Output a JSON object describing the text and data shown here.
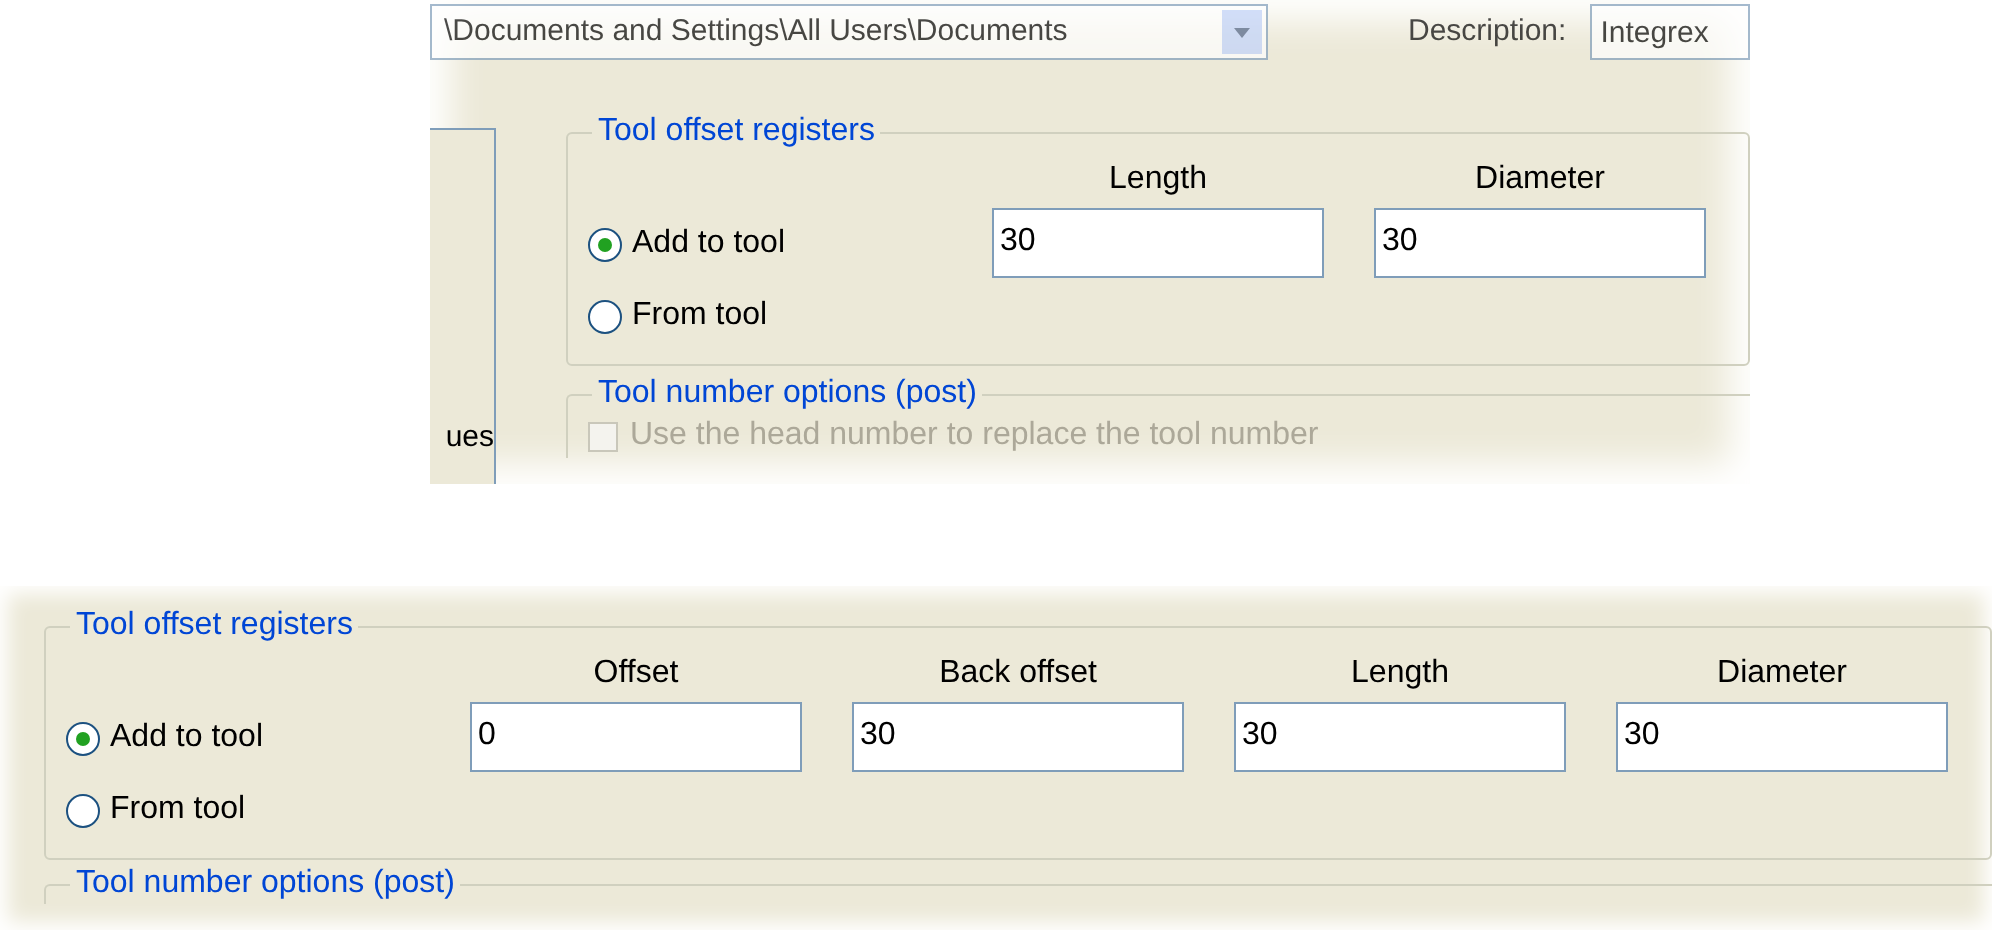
{
  "panels": [
    {
      "path_field": "\\Documents and Settings\\All Users\\Documents",
      "description_label": "Description:",
      "description_field": "Integrex",
      "side_label": "ues",
      "offset_group": {
        "title": "Tool offset registers",
        "options": [
          {
            "label": "Add to tool",
            "selected": true
          },
          {
            "label": "From tool",
            "selected": false
          }
        ],
        "fields": [
          {
            "label": "Length",
            "value": "30"
          },
          {
            "label": "Diameter",
            "value": "30"
          }
        ]
      },
      "number_group": {
        "title": "Tool number options (post)",
        "checkbox": {
          "label": "Use the head number to replace the tool number",
          "checked": false,
          "disabled": true
        }
      }
    },
    {
      "offset_group": {
        "title": "Tool offset registers",
        "options": [
          {
            "label": "Add to tool",
            "selected": true
          },
          {
            "label": "From tool",
            "selected": false
          }
        ],
        "fields": [
          {
            "label": "Offset",
            "value": "0"
          },
          {
            "label": "Back offset",
            "value": "30"
          },
          {
            "label": "Length",
            "value": "30"
          },
          {
            "label": "Diameter",
            "value": "30"
          }
        ]
      },
      "number_group": {
        "title": "Tool number options (post)"
      }
    }
  ]
}
